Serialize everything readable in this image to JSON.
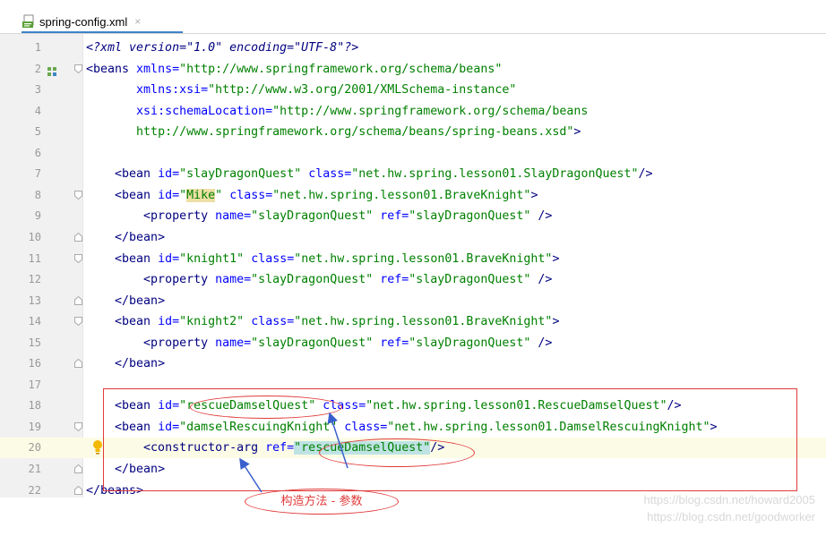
{
  "tab": {
    "filename": "spring-config.xml",
    "close": "×"
  },
  "code_lines": [
    {
      "n": "1",
      "segs": [
        {
          "t": "<?xml version=\"1.0\" encoding=\"UTF-8\"?>",
          "c": "pi"
        }
      ]
    },
    {
      "n": "2",
      "segs": [
        {
          "t": "<beans ",
          "c": "tag"
        },
        {
          "t": "xmlns=",
          "c": "attr"
        },
        {
          "t": "\"http://www.springframework.org/schema/beans\"",
          "c": "val"
        }
      ]
    },
    {
      "n": "3",
      "segs": [
        {
          "t": "       "
        },
        {
          "t": "xmlns:xsi=",
          "c": "attr"
        },
        {
          "t": "\"http://www.w3.org/2001/XMLSchema-instance\"",
          "c": "val"
        }
      ]
    },
    {
      "n": "4",
      "segs": [
        {
          "t": "       "
        },
        {
          "t": "xsi:schemaLocation=",
          "c": "attr"
        },
        {
          "t": "\"http://www.springframework.org/schema/beans",
          "c": "val"
        }
      ]
    },
    {
      "n": "5",
      "segs": [
        {
          "t": "       "
        },
        {
          "t": "http://www.springframework.org/schema/beans/spring-beans.xsd\"",
          "c": "val"
        },
        {
          "t": ">",
          "c": "tag"
        }
      ]
    },
    {
      "n": "6",
      "segs": []
    },
    {
      "n": "7",
      "segs": [
        {
          "t": "    "
        },
        {
          "t": "<bean ",
          "c": "tag"
        },
        {
          "t": "id=",
          "c": "attr"
        },
        {
          "t": "\"slayDragonQuest\"",
          "c": "val"
        },
        {
          "t": " "
        },
        {
          "t": "class=",
          "c": "attr"
        },
        {
          "t": "\"net.hw.spring.lesson01.SlayDragonQuest\"",
          "c": "val"
        },
        {
          "t": "/>",
          "c": "tag"
        }
      ]
    },
    {
      "n": "8",
      "segs": [
        {
          "t": "    "
        },
        {
          "t": "<bean ",
          "c": "tag"
        },
        {
          "t": "id=",
          "c": "attr"
        },
        {
          "t": "\"",
          "c": "val"
        },
        {
          "t": "Mike",
          "c": "mike"
        },
        {
          "t": "\"",
          "c": "val"
        },
        {
          "t": " "
        },
        {
          "t": "class=",
          "c": "attr"
        },
        {
          "t": "\"net.hw.spring.lesson01.BraveKnight\"",
          "c": "val"
        },
        {
          "t": ">",
          "c": "tag"
        }
      ]
    },
    {
      "n": "9",
      "segs": [
        {
          "t": "        "
        },
        {
          "t": "<property ",
          "c": "tag"
        },
        {
          "t": "name=",
          "c": "attr"
        },
        {
          "t": "\"slayDragonQuest\"",
          "c": "val"
        },
        {
          "t": " "
        },
        {
          "t": "ref=",
          "c": "attr"
        },
        {
          "t": "\"slayDragonQuest\"",
          "c": "val"
        },
        {
          "t": " />",
          "c": "tag"
        }
      ]
    },
    {
      "n": "10",
      "segs": [
        {
          "t": "    "
        },
        {
          "t": "</bean>",
          "c": "tag"
        }
      ]
    },
    {
      "n": "11",
      "segs": [
        {
          "t": "    "
        },
        {
          "t": "<bean ",
          "c": "tag"
        },
        {
          "t": "id=",
          "c": "attr"
        },
        {
          "t": "\"knight1\"",
          "c": "val"
        },
        {
          "t": " "
        },
        {
          "t": "class=",
          "c": "attr"
        },
        {
          "t": "\"net.hw.spring.lesson01.BraveKnight\"",
          "c": "val"
        },
        {
          "t": ">",
          "c": "tag"
        }
      ]
    },
    {
      "n": "12",
      "segs": [
        {
          "t": "        "
        },
        {
          "t": "<property ",
          "c": "tag"
        },
        {
          "t": "name=",
          "c": "attr"
        },
        {
          "t": "\"slayDragonQuest\"",
          "c": "val"
        },
        {
          "t": " "
        },
        {
          "t": "ref=",
          "c": "attr"
        },
        {
          "t": "\"slayDragonQuest\"",
          "c": "val"
        },
        {
          "t": " />",
          "c": "tag"
        }
      ]
    },
    {
      "n": "13",
      "segs": [
        {
          "t": "    "
        },
        {
          "t": "</bean>",
          "c": "tag"
        }
      ]
    },
    {
      "n": "14",
      "segs": [
        {
          "t": "    "
        },
        {
          "t": "<bean ",
          "c": "tag"
        },
        {
          "t": "id=",
          "c": "attr"
        },
        {
          "t": "\"knight2\"",
          "c": "val"
        },
        {
          "t": " "
        },
        {
          "t": "class=",
          "c": "attr"
        },
        {
          "t": "\"net.hw.spring.lesson01.BraveKnight\"",
          "c": "val"
        },
        {
          "t": ">",
          "c": "tag"
        }
      ]
    },
    {
      "n": "15",
      "segs": [
        {
          "t": "        "
        },
        {
          "t": "<property ",
          "c": "tag"
        },
        {
          "t": "name=",
          "c": "attr"
        },
        {
          "t": "\"slayDragonQuest\"",
          "c": "val"
        },
        {
          "t": " "
        },
        {
          "t": "ref=",
          "c": "attr"
        },
        {
          "t": "\"slayDragonQuest\"",
          "c": "val"
        },
        {
          "t": " />",
          "c": "tag"
        }
      ]
    },
    {
      "n": "16",
      "segs": [
        {
          "t": "    "
        },
        {
          "t": "</bean>",
          "c": "tag"
        }
      ]
    },
    {
      "n": "17",
      "segs": []
    },
    {
      "n": "18",
      "segs": [
        {
          "t": "    "
        },
        {
          "t": "<bean ",
          "c": "tag"
        },
        {
          "t": "id=",
          "c": "attr"
        },
        {
          "t": "\"rescueDamselQuest\"",
          "c": "val"
        },
        {
          "t": " "
        },
        {
          "t": "class=",
          "c": "attr"
        },
        {
          "t": "\"net.hw.spring.lesson01.RescueDamselQuest\"",
          "c": "val"
        },
        {
          "t": "/>",
          "c": "tag"
        }
      ]
    },
    {
      "n": "19",
      "segs": [
        {
          "t": "    "
        },
        {
          "t": "<bean ",
          "c": "tag"
        },
        {
          "t": "id=",
          "c": "attr"
        },
        {
          "t": "\"damselRescuingKnight\"",
          "c": "val"
        },
        {
          "t": " "
        },
        {
          "t": "class=",
          "c": "attr"
        },
        {
          "t": "\"net.hw.spring.lesson01.DamselRescuingKnight\"",
          "c": "val"
        },
        {
          "t": ">",
          "c": "tag"
        }
      ]
    },
    {
      "n": "20",
      "segs": [
        {
          "t": "        "
        },
        {
          "t": "<constructor-arg ",
          "c": "tag"
        },
        {
          "t": "ref=",
          "c": "attr"
        },
        {
          "t": "\"rescueDamselQuest\"",
          "c": "val rdq"
        },
        {
          "t": "/>",
          "c": "tag"
        }
      ]
    },
    {
      "n": "21",
      "segs": [
        {
          "t": "    "
        },
        {
          "t": "</bean>",
          "c": "tag"
        }
      ]
    },
    {
      "n": "22",
      "segs": [
        {
          "t": "</beans>",
          "c": "tag"
        }
      ]
    }
  ],
  "annotation": {
    "label": "构造方法 - 参数"
  },
  "watermark": [
    "https://blog.csdn.net/howard2005",
    "https://blog.csdn.net/goodworker"
  ],
  "colors": {
    "tag": "#000080",
    "attr": "#0000ff",
    "value": "#008000",
    "annotation": "#e03a3a",
    "current_line": "#fcfce6"
  }
}
